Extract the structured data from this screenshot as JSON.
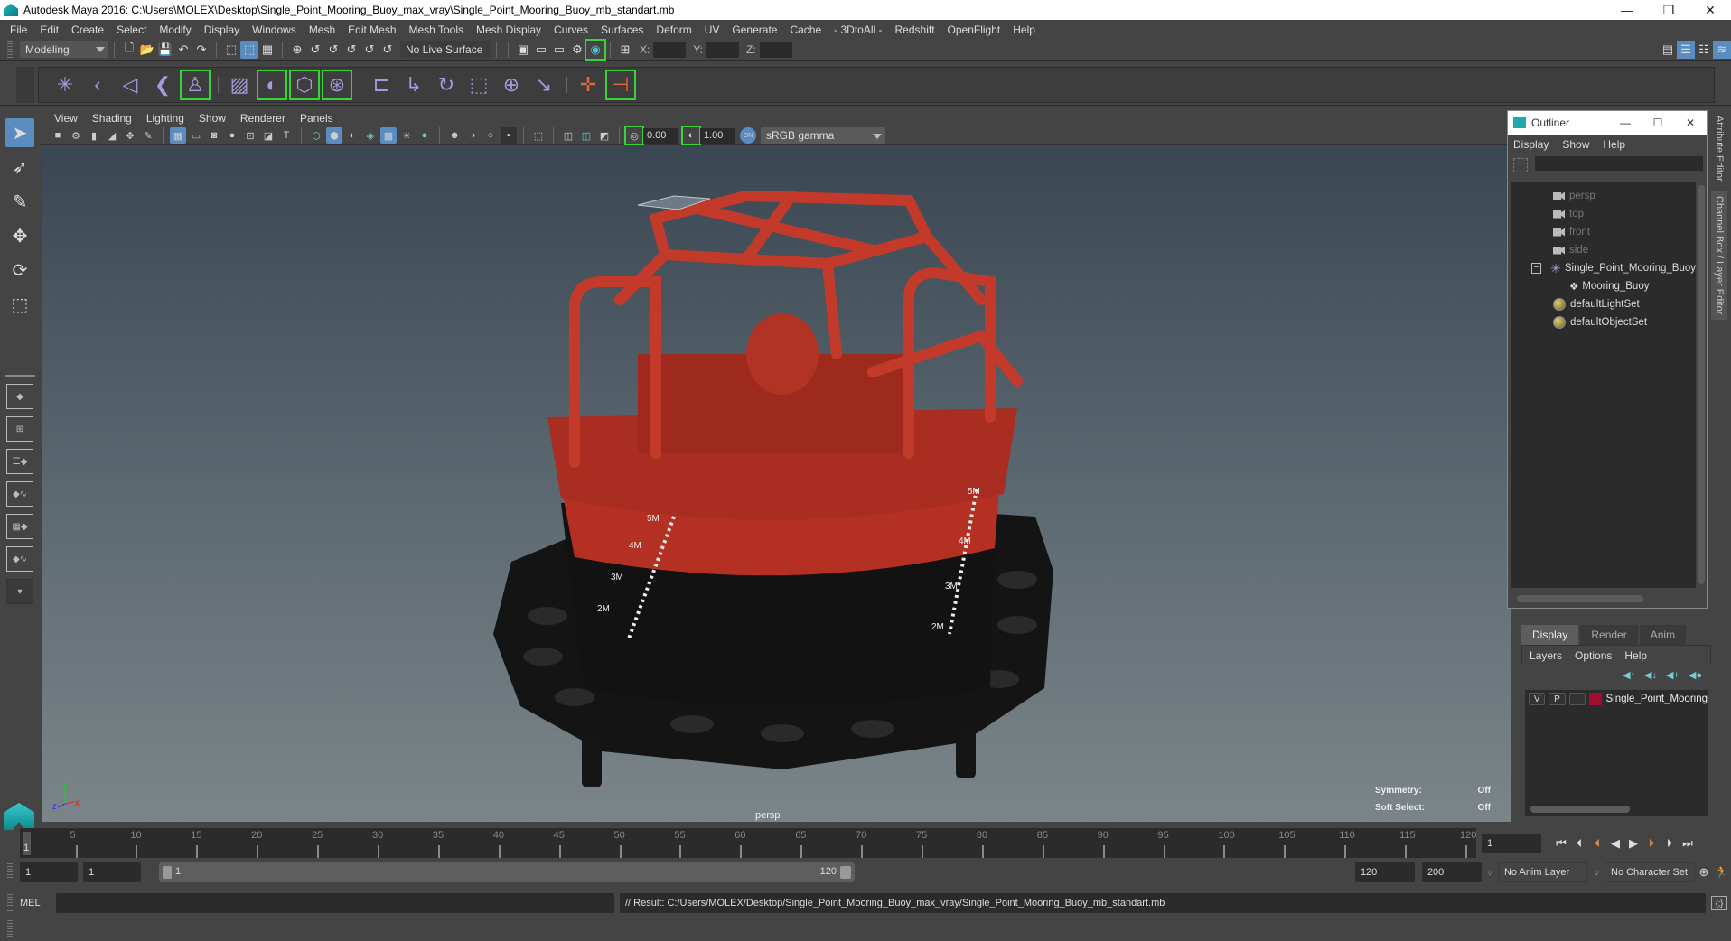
{
  "window": {
    "title": "Autodesk Maya 2016: C:\\Users\\MOLEX\\Desktop\\Single_Point_Mooring_Buoy_max_vray\\Single_Point_Mooring_Buoy_mb_standart.mb",
    "minimize": "—",
    "restore": "❐",
    "close": "✕"
  },
  "menubar": [
    "File",
    "Edit",
    "Create",
    "Select",
    "Modify",
    "Display",
    "Windows",
    "Mesh",
    "Edit Mesh",
    "Mesh Tools",
    "Mesh Display",
    "Curves",
    "Surfaces",
    "Deform",
    "UV",
    "Generate",
    "Cache",
    "- 3DtoAll -",
    "Redshift",
    "OpenFlight",
    "Help"
  ],
  "statusline": {
    "mode": "Modeling",
    "live_surface": "No Live Surface",
    "x_label": "X:",
    "y_label": "Y:",
    "z_label": "Z:",
    "x_value": "",
    "y_value": "",
    "z_value": ""
  },
  "viewport": {
    "menu": [
      "View",
      "Shading",
      "Lighting",
      "Show",
      "Renderer",
      "Panels"
    ],
    "exposure": "0.00",
    "gamma": "1.00",
    "color_management_badge": "ON",
    "color_space": "sRGB gamma",
    "camera_label": "persp",
    "hud": [
      {
        "label": "Symmetry:",
        "value": "Off"
      },
      {
        "label": "Soft Select:",
        "value": "Off"
      }
    ],
    "axis": {
      "x": "x",
      "y": "y",
      "z": "z"
    },
    "model_marks": [
      "5M",
      "4M",
      "3M",
      "2M"
    ]
  },
  "outliner": {
    "title": "Outliner",
    "menu": [
      "Display",
      "Show",
      "Help"
    ],
    "search_value": "",
    "items": [
      {
        "label": "persp",
        "type": "camera",
        "dim": true
      },
      {
        "label": "top",
        "type": "camera",
        "dim": true
      },
      {
        "label": "front",
        "type": "camera",
        "dim": true
      },
      {
        "label": "side",
        "type": "camera",
        "dim": true
      },
      {
        "label": "Single_Point_Mooring_Buoy",
        "type": "group",
        "expanded": true
      },
      {
        "label": "Mooring_Buoy",
        "type": "mesh",
        "child": true
      },
      {
        "label": "defaultLightSet",
        "type": "set"
      },
      {
        "label": "defaultObjectSet",
        "type": "set"
      }
    ]
  },
  "side_tabs": [
    "Attribute Editor",
    "Channel Box / Layer Editor"
  ],
  "layer_editor": {
    "tabs": [
      "Display",
      "Render",
      "Anim"
    ],
    "active_tab": "Display",
    "menu": [
      "Layers",
      "Options",
      "Help"
    ],
    "layers": [
      {
        "v": "V",
        "p": "P",
        "name": "Single_Point_Mooring",
        "color": "#a00d2e"
      }
    ]
  },
  "timeline": {
    "ticks": [
      5,
      10,
      15,
      20,
      25,
      30,
      35,
      40,
      45,
      50,
      55,
      60,
      65,
      70,
      75,
      80,
      85,
      90,
      95,
      100,
      105,
      110,
      115,
      120
    ],
    "start": 1,
    "end": 120,
    "current_frame_label": "1",
    "current_frame": "1"
  },
  "range": {
    "start_time": "1",
    "playback_start": "1",
    "slider_start": "1",
    "slider_end": "120",
    "playback_end": "120",
    "end_time": "200",
    "anim_layer": "No Anim Layer",
    "character_set": "No Character Set"
  },
  "command_line": {
    "language": "MEL",
    "input": "",
    "result": "// Result: C:/Users/MOLEX/Desktop/Single_Point_Mooring_Buoy_max_vray/Single_Point_Mooring_Buoy_mb_standart.mb"
  },
  "colors": {
    "accent": "#5a8cbf",
    "shelf_highlight": "#39d239",
    "model_red": "#b83224",
    "layer_swatch": "#a00d2e"
  }
}
